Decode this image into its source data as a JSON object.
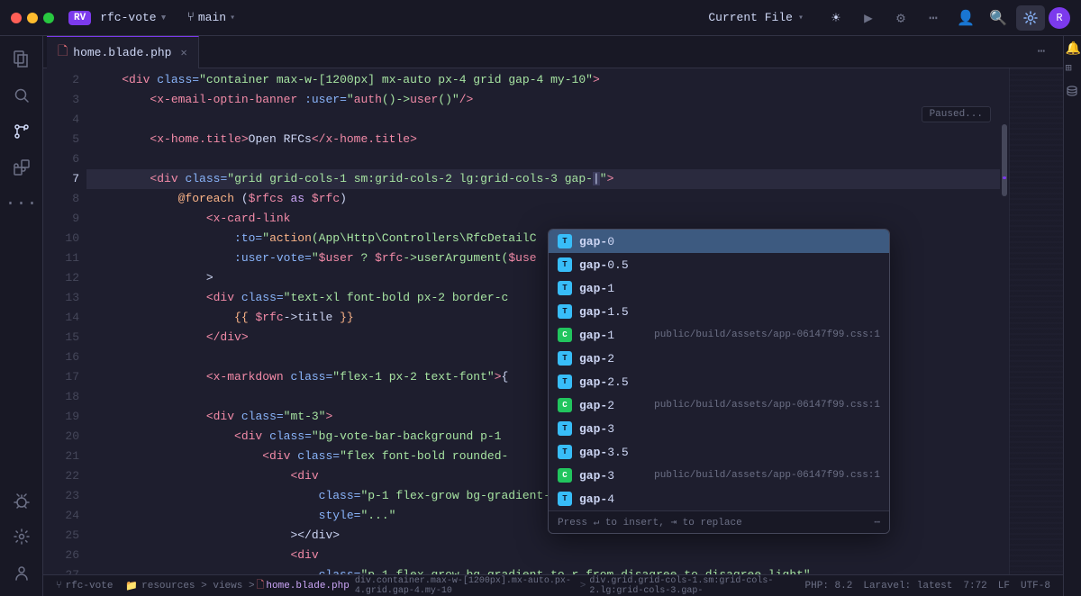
{
  "titlebar": {
    "traffic_lights": [
      "red",
      "yellow",
      "green"
    ],
    "project_badge": "RV",
    "project_name": "rfc-vote",
    "branch": "main",
    "current_file_label": "Current File",
    "buttons": [
      "sun-icon",
      "play-icon",
      "gear-icon",
      "more-icon",
      "user-icon",
      "search-icon",
      "settings-icon",
      "extensions-icon"
    ]
  },
  "tabs": [
    {
      "name": "home.blade.php",
      "active": true,
      "modified": false
    }
  ],
  "editor": {
    "lines": [
      {
        "num": 2,
        "content": "    <div class=\"container max-w-[1200px] mx-auto px-4 grid gap-4 my-10\">"
      },
      {
        "num": 3,
        "content": "        <x-email-optin-banner :user=\"auth()->user()\"/>"
      },
      {
        "num": 4,
        "content": ""
      },
      {
        "num": 5,
        "content": "        <x-home.title>Open RFCs</x-home.title>"
      },
      {
        "num": 6,
        "content": ""
      },
      {
        "num": 7,
        "content": "        <div class=\"grid grid-cols-1 sm:grid-cols-2 lg:grid-cols-3 gap-\">",
        "highlighted": true
      },
      {
        "num": 8,
        "content": "            @foreach ($rfcs as $rfc)"
      },
      {
        "num": 9,
        "content": "                <x-card-link"
      },
      {
        "num": 10,
        "content": "                    :to=\"action(App\\Http\\Controllers\\RfcDetailC"
      },
      {
        "num": 11,
        "content": "                    :user-vote=\"$user ? $rfc->userArgument($use"
      },
      {
        "num": 12,
        "content": "                >"
      },
      {
        "num": 13,
        "content": "                <div class=\"text-xl font-bold px-2 border-c"
      },
      {
        "num": 14,
        "content": "                    {{ $rfc->title }}"
      },
      {
        "num": 15,
        "content": "                </div>"
      },
      {
        "num": 16,
        "content": ""
      },
      {
        "num": 17,
        "content": "                <x-markdown class=\"flex-1 px-2 text-font\">{"
      },
      {
        "num": 18,
        "content": ""
      },
      {
        "num": 19,
        "content": "                <div class=\"mt-3\">"
      },
      {
        "num": 20,
        "content": "                    <div class=\"bg-vote-bar-background p-1"
      },
      {
        "num": 21,
        "content": "                        <div class=\"flex font-bold rounded-"
      },
      {
        "num": 22,
        "content": "                            <div"
      },
      {
        "num": 23,
        "content": "                                class=\"p-1 flex-grow bg-gradient-to-r from-agree to-agree-light\""
      },
      {
        "num": 24,
        "content": "                                style=\"...\""
      },
      {
        "num": 25,
        "content": "                            ></div>"
      },
      {
        "num": 26,
        "content": "                            <div"
      },
      {
        "num": 27,
        "content": "                                class=\"p-1 flex-grow bg-gradient-to-r from-disagree to-disagree-light\""
      }
    ]
  },
  "autocomplete": {
    "items": [
      {
        "icon_type": "tw",
        "label": "gap-0",
        "source": "",
        "selected": true
      },
      {
        "icon_type": "tw",
        "label": "gap-0.5",
        "source": ""
      },
      {
        "icon_type": "tw",
        "label": "gap-1",
        "source": ""
      },
      {
        "icon_type": "tw",
        "label": "gap-1.5",
        "source": ""
      },
      {
        "icon_type": "green",
        "label": "gap-1",
        "source": "public/build/assets/app-06147f99.css:1"
      },
      {
        "icon_type": "tw",
        "label": "gap-2",
        "source": ""
      },
      {
        "icon_type": "tw",
        "label": "gap-2.5",
        "source": ""
      },
      {
        "icon_type": "green",
        "label": "gap-2",
        "source": "public/build/assets/app-06147f99.css:1"
      },
      {
        "icon_type": "tw",
        "label": "gap-3",
        "source": ""
      },
      {
        "icon_type": "tw",
        "label": "gap-3.5",
        "source": ""
      },
      {
        "icon_type": "green",
        "label": "gap-3",
        "source": "public/build/assets/app-06147f99.css:1"
      },
      {
        "icon_type": "tw",
        "label": "gap-4",
        "source": ""
      }
    ],
    "footer": {
      "insert_hint": "Press ↵ to insert, ⇥ to replace",
      "more_icon": "⋯"
    }
  },
  "paused_label": "Paused...",
  "status_bar": {
    "left": [
      {
        "label": "rfc-vote",
        "icon": "git-branch"
      },
      {
        "label": "resources > views > home.blade.php"
      }
    ],
    "breadcrumb": {
      "parts": [
        "div.container.max-w-[1200px].mx-auto.px-4.grid.gap-4.my-10",
        "div.grid.grid-cols-1.sm:grid-cols-2.lg:grid-cols-3.gap-"
      ]
    },
    "right": [
      {
        "label": "PHP: 8.2"
      },
      {
        "label": "Laravel: latest"
      },
      {
        "label": "7:72"
      },
      {
        "label": "LF"
      },
      {
        "label": "UTF-8"
      }
    ]
  }
}
